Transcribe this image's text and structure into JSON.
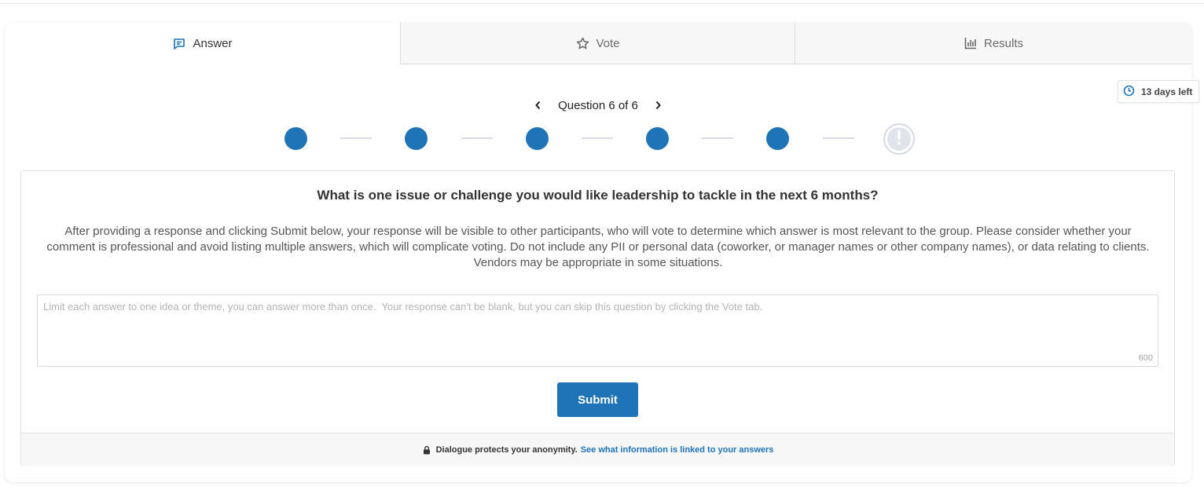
{
  "tabs": {
    "answer": {
      "label": "Answer",
      "icon": "comment-icon",
      "active": true
    },
    "vote": {
      "label": "Vote",
      "icon": "star-icon",
      "active": false
    },
    "results": {
      "label": "Results",
      "icon": "bar-chart-icon",
      "active": false
    }
  },
  "deadline": {
    "label": "13 days left",
    "icon": "clock-icon"
  },
  "question_nav": {
    "label": "Question 6 of 6",
    "current": 6,
    "total": 6,
    "completed_steps": 5,
    "current_step_icon": "exclamation-icon"
  },
  "question": {
    "title": "What is one issue or challenge you would like leadership to tackle in the next 6 months?",
    "instructions": "After providing a response and clicking Submit below, your response will be visible to other participants, who will vote to determine which answer is most relevant to the group. Please consider whether your comment is professional and avoid listing multiple answers, which will complicate voting. Do not include any PII or personal data (coworker, or manager names or other company names), or data relating to clients. Vendors may be appropriate in some situations."
  },
  "answer_input": {
    "value": "",
    "placeholder": "Limit each answer to one idea or theme, you can answer more than once.  Your response can't be blank, but you can skip this question by clicking the Vote tab.",
    "char_limit": "600"
  },
  "submit": {
    "label": "Submit"
  },
  "footer": {
    "note": "Dialogue protects your anonymity.",
    "link": "See what information is linked to your answers",
    "icon": "lock-icon"
  },
  "colors": {
    "accent": "#1f73b7",
    "step_inactive": "#e1e4ea"
  }
}
